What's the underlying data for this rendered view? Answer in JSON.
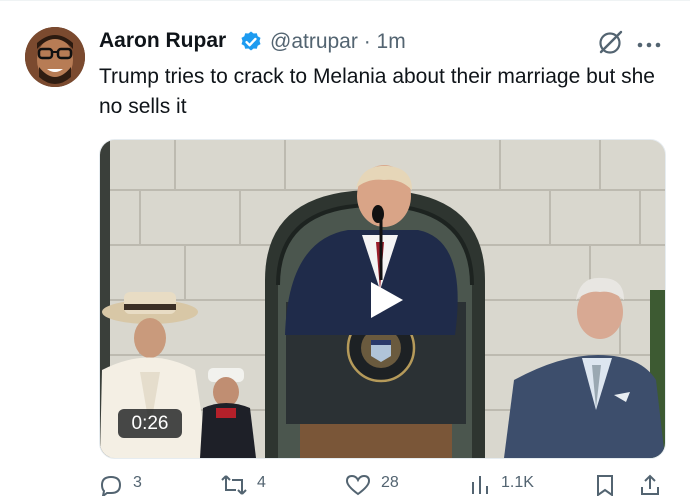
{
  "tweet": {
    "display_name": "Aaron Rupar",
    "handle": "@atrupar",
    "separator": "·",
    "time": "1m",
    "text": "Trump tries to crack to Melania about their marriage but she no sells it",
    "verified_color": "#1d9bf0"
  },
  "media": {
    "duration": "0:26",
    "type": "video"
  },
  "actions": {
    "replies": "3",
    "reposts": "4",
    "likes": "28",
    "views": "1.1K"
  },
  "icons": [
    "avatar",
    "verified-badge-icon",
    "grok-icon",
    "more-icon",
    "play-icon",
    "reply-icon",
    "repost-icon",
    "like-icon",
    "views-icon",
    "bookmark-icon",
    "share-icon"
  ]
}
